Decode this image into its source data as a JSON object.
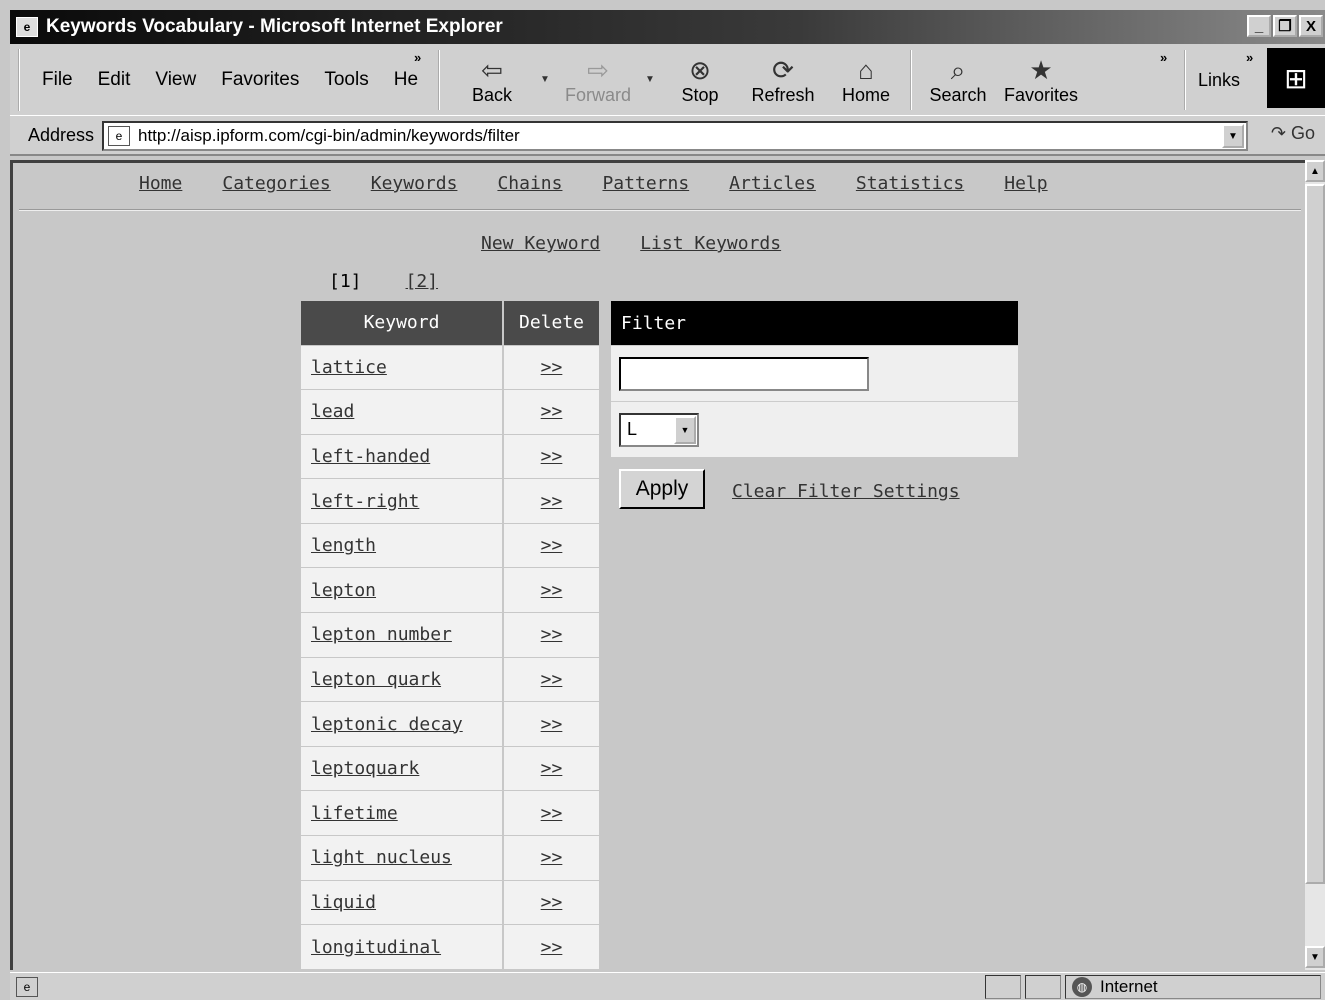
{
  "window": {
    "title": "Keywords Vocabulary - Microsoft Internet Explorer",
    "minimize": "_",
    "restore": "❐",
    "close": "X"
  },
  "menu": {
    "items": [
      "File",
      "Edit",
      "View",
      "Favorites",
      "Tools",
      "He"
    ],
    "overflow": "»"
  },
  "toolbar": {
    "back": "Back",
    "forward": "Forward",
    "stop": "Stop",
    "refresh": "Refresh",
    "home": "Home",
    "search": "Search",
    "favorites": "Favorites",
    "overflow": "»",
    "links": "Links",
    "links_overflow": "»"
  },
  "address": {
    "label": "Address",
    "url": "http://aisp.ipform.com/cgi-bin/admin/keywords/filter",
    "go": "Go"
  },
  "nav": {
    "items": [
      "Home",
      "Categories",
      "Keywords",
      "Chains",
      "Patterns",
      "Articles",
      "Statistics",
      "Help"
    ]
  },
  "sublinks": {
    "new_keyword": "New Keyword",
    "list_keywords": "List Keywords"
  },
  "pager": {
    "current": "[1]",
    "page2": "[2]"
  },
  "table": {
    "headers": {
      "keyword": "Keyword",
      "delete": "Delete"
    },
    "delete_label": ">>",
    "rows": [
      "lattice",
      "lead",
      "left-handed",
      "left-right",
      "length",
      "lepton",
      "lepton number",
      "lepton quark",
      "leptonic decay",
      "leptoquark",
      "lifetime",
      "light nucleus",
      "liquid",
      "longitudinal"
    ]
  },
  "filter": {
    "heading": "Filter",
    "text_value": "",
    "letter_selected": "L",
    "apply": "Apply",
    "clear": "Clear Filter Settings"
  },
  "status": {
    "zone": "Internet"
  }
}
